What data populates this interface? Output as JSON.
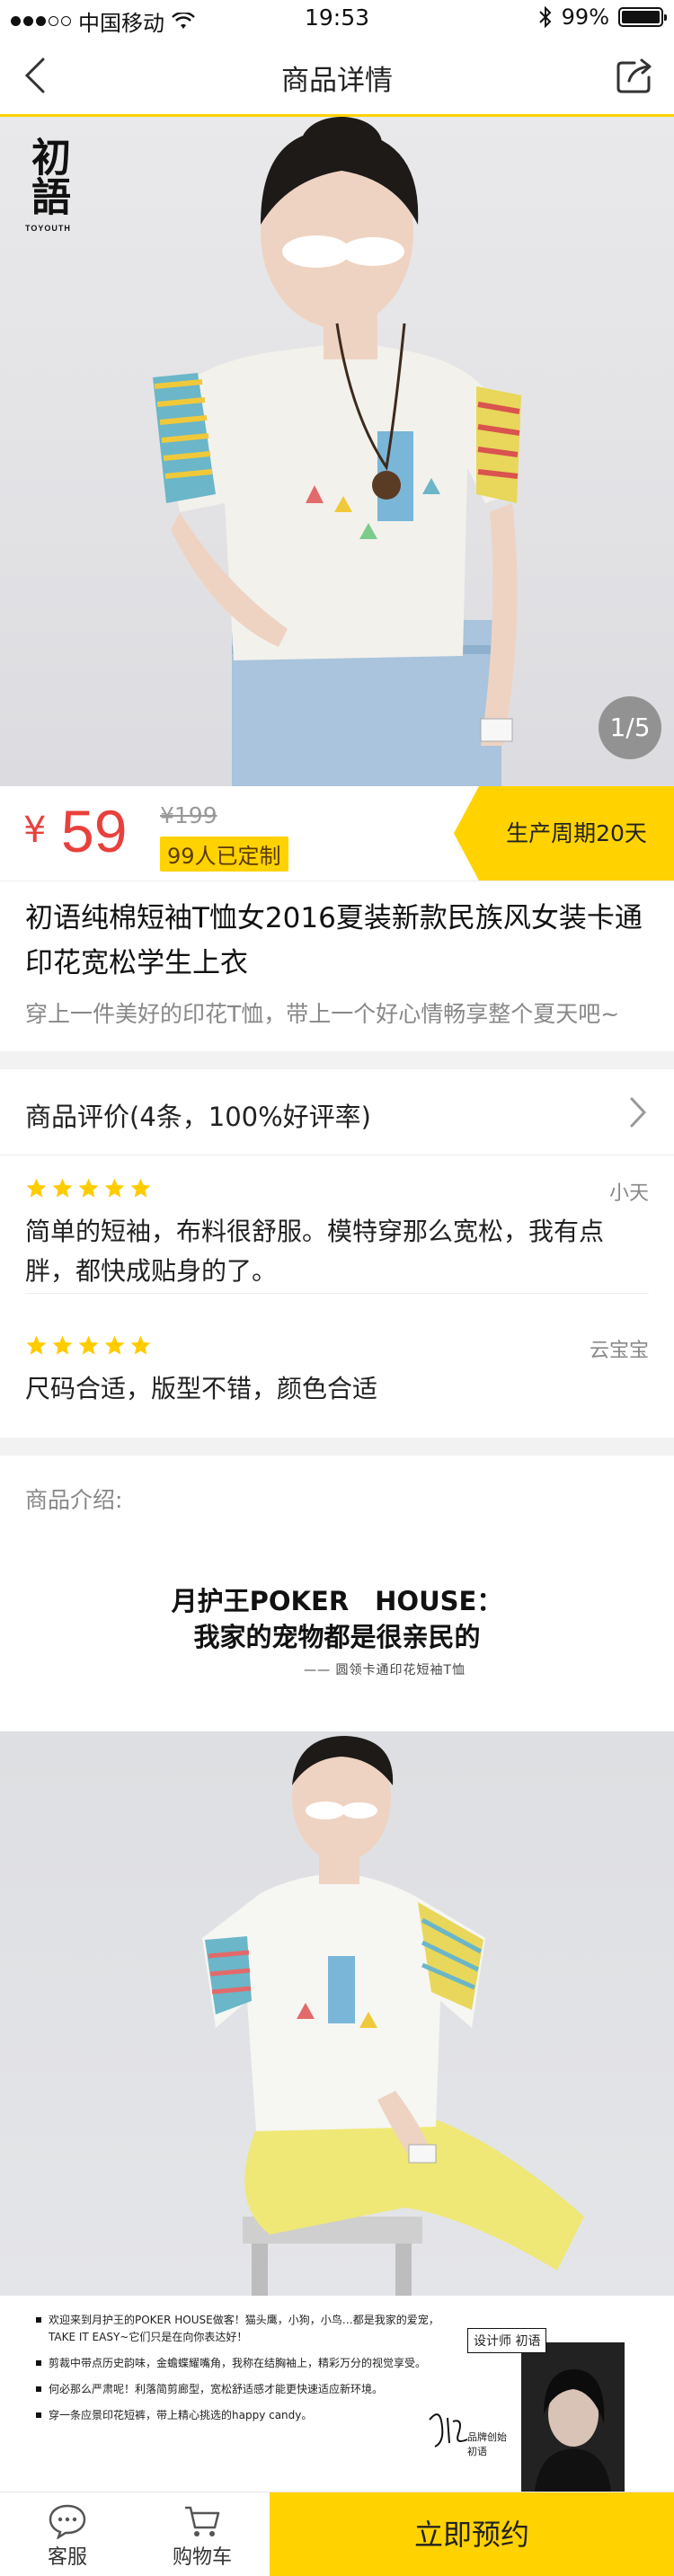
{
  "status_bar": {
    "carrier": "中国移动",
    "time": "19:53",
    "battery": "99%",
    "battery_level": 0.99
  },
  "nav": {
    "title": "商品详情",
    "back_icon": "back-chevron-icon",
    "share_icon": "share-icon"
  },
  "hero": {
    "brand_logo_text": "初語",
    "brand_logo_sub": "TOYOUTH",
    "page_indicator": "1/5"
  },
  "price": {
    "currency": "¥",
    "current": "59",
    "original": "¥199",
    "custom_count": "99人已定制",
    "production_cycle": "生产周期20天"
  },
  "product": {
    "title": "初语纯棉短袖T恤女2016夏装新款民族风女装卡通印花宽松学生上衣",
    "subtitle": "穿上一件美好的印花T恤，带上一个好心情畅享整个夏天吧~"
  },
  "reviews": {
    "header": "商品评价(4条，100%好评率)",
    "items": [
      {
        "user": "小天",
        "stars": 5,
        "text": "简单的短袖，布料很舒服。模特穿那么宽松，我有点胖，都快成贴身的了。"
      },
      {
        "user": "云宝宝",
        "stars": 5,
        "text": "尺码合适，版型不错，颜色合适"
      }
    ]
  },
  "intro": {
    "label": "商品介绍:",
    "heading_line1": "月护王POKER　HOUSE：",
    "heading_line2": "我家的宠物都是很亲民的",
    "caption": "—— 圆领卡通印花短袖T恤"
  },
  "story": {
    "items": [
      "欢迎来到月护王的POKER HOUSE做客！猫头鹰，小狗，小鸟…都是我家的爱宠，TAKE IT EASY~它们只是在向你表达好！",
      "剪裁中带点历史韵味，金蟾蝶耀嘴角，我称在结胸袖上，精彩万分的视觉享受。",
      "何必那么严肃呢！利落简剪廊型，宽松舒适感才能更快速适应新环境。",
      "穿一条应景印花短裤，带上精心挑选的happy candy。"
    ],
    "designer_label": "设计师 初语",
    "signature_caption_1": "品牌创始",
    "signature_caption_2": "初语"
  },
  "bottom_bar": {
    "service_label": "客服",
    "cart_label": "购物车",
    "cta_label": "立即预约"
  },
  "colors": {
    "accent": "#ffd200",
    "price_red": "#e8413d",
    "star_yellow": "#ffcc00"
  }
}
